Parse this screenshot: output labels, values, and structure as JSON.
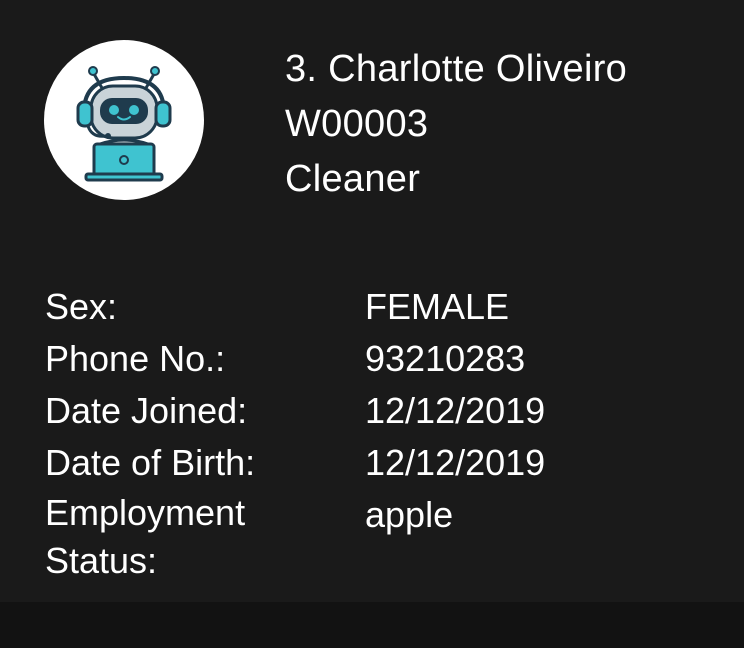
{
  "person": {
    "name": "3. Charlotte Oliveiro",
    "id": "W00003",
    "role": "Cleaner",
    "avatar_icon": "robot-headset-laptop-icon"
  },
  "details": [
    {
      "label": "Sex:",
      "value": "FEMALE"
    },
    {
      "label": "Phone No.:",
      "value": "93210283"
    },
    {
      "label": "Date Joined:",
      "value": "12/12/2019"
    },
    {
      "label": "Date of Birth:",
      "value": "12/12/2019"
    },
    {
      "label": "Employment Status:",
      "value": "apple"
    }
  ],
  "colors": {
    "background": "#1a1a1a",
    "text": "#ffffff",
    "avatar_bg": "#ffffff",
    "robot_accent": "#3fc3d0",
    "robot_dark": "#1f3b4d"
  }
}
